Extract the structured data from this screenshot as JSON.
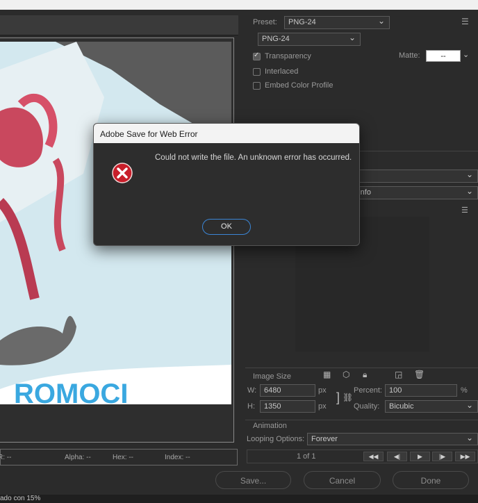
{
  "preset": {
    "label": "Preset:",
    "value": "PNG-24",
    "format": "PNG-24",
    "transparency": "Transparency",
    "matte_label": "Matte:",
    "matte_value": "--",
    "interlaced": "Interlaced",
    "embed_color": "Embed Color Profile"
  },
  "color_panel": {
    "dropdown_2": "ct Info"
  },
  "image_size": {
    "title": "Image Size",
    "w_label": "W:",
    "w_value": "6480",
    "h_label": "H:",
    "h_value": "1350",
    "px": "px",
    "percent_label": "Percent:",
    "percent_value": "100",
    "percent_unit": "%",
    "quality_label": "Quality:",
    "quality_value": "Bicubic"
  },
  "animation": {
    "title": "Animation",
    "looping_label": "Looping Options:",
    "looping_value": "Forever",
    "frame_count": "1 of 1"
  },
  "status": {
    "r": "R: --",
    "alpha": "Alpha: --",
    "hex": "Hex: --",
    "index": "Index: --"
  },
  "buttons": {
    "save": "Save...",
    "cancel": "Cancel",
    "done": "Done"
  },
  "bottom_text": "ado con 15%",
  "dialog": {
    "title": "Adobe Save for Web Error",
    "message": "Could not write the file. An unknown error has occurred.",
    "ok": "OK"
  }
}
